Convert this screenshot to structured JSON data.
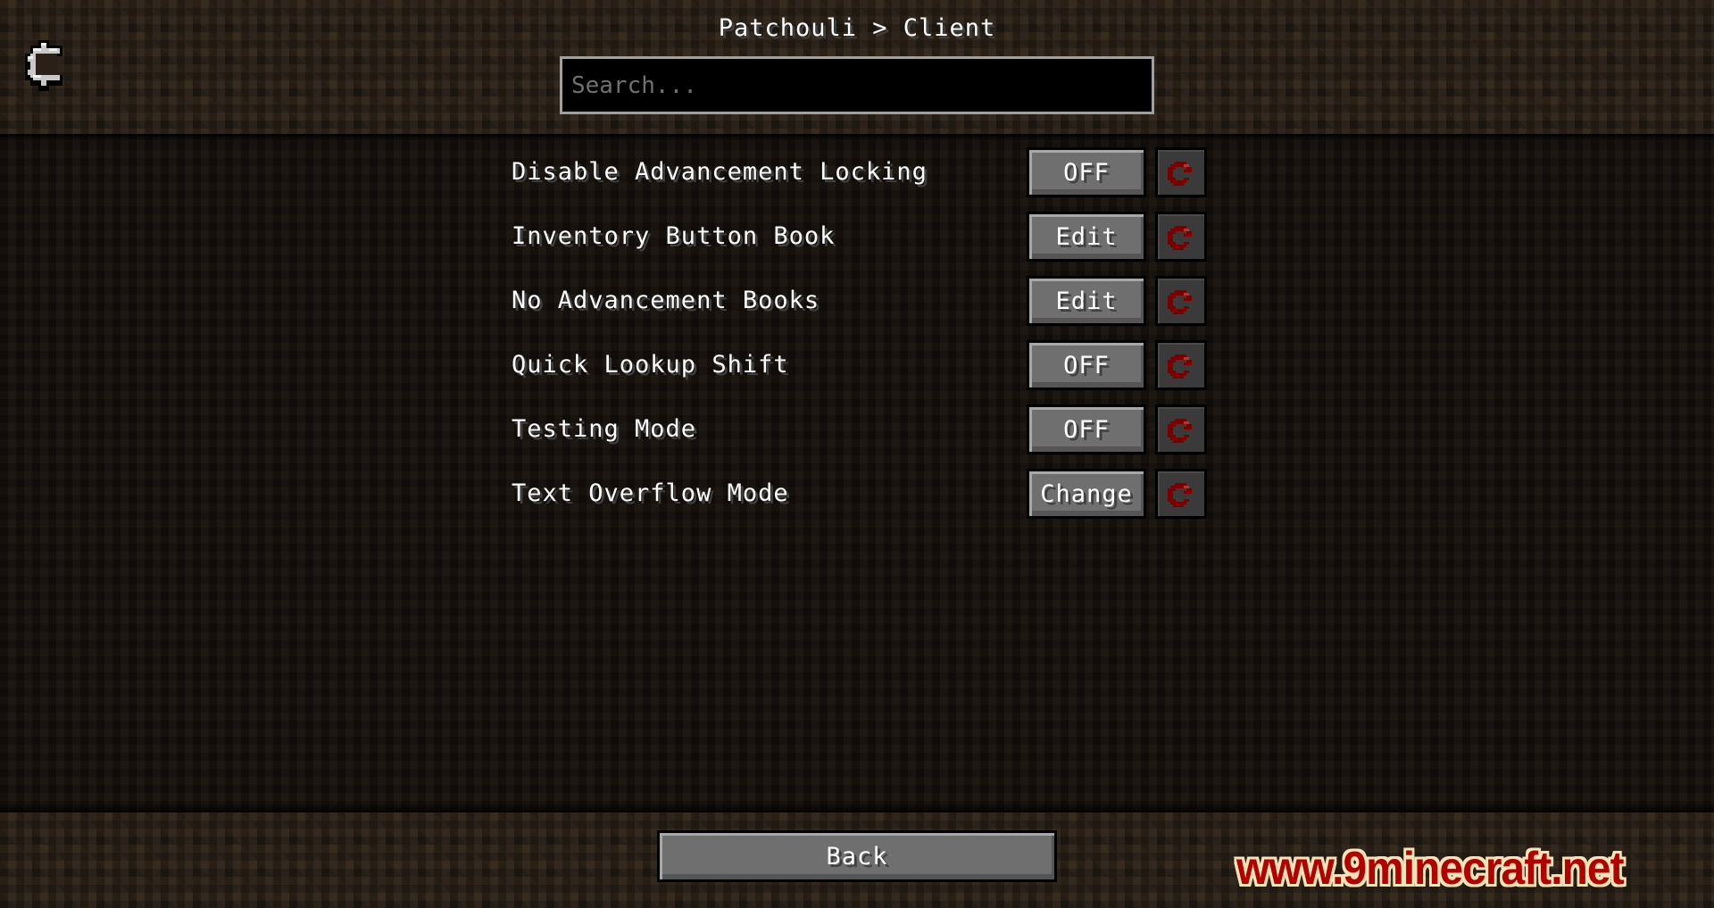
{
  "header": {
    "title": "Patchouli > Client",
    "search": {
      "value": "",
      "placeholder": "Search..."
    }
  },
  "icons": {
    "settings": "gear-icon",
    "reset": "reset-icon"
  },
  "settings": [
    {
      "label": "Disable Advancement Locking",
      "button": "OFF"
    },
    {
      "label": "Inventory Button Book",
      "button": "Edit"
    },
    {
      "label": "No Advancement Books",
      "button": "Edit"
    },
    {
      "label": "Quick Lookup Shift",
      "button": "OFF"
    },
    {
      "label": "Testing Mode",
      "button": "OFF"
    },
    {
      "label": "Text Overflow Mode",
      "button": "Change"
    }
  ],
  "footer": {
    "back_label": "Back",
    "watermark": "www.9minecraft.net"
  },
  "colors": {
    "reset_icon": "#8b0000",
    "watermark_text": "#b30000",
    "watermark_outline": "#f2e4b8"
  }
}
